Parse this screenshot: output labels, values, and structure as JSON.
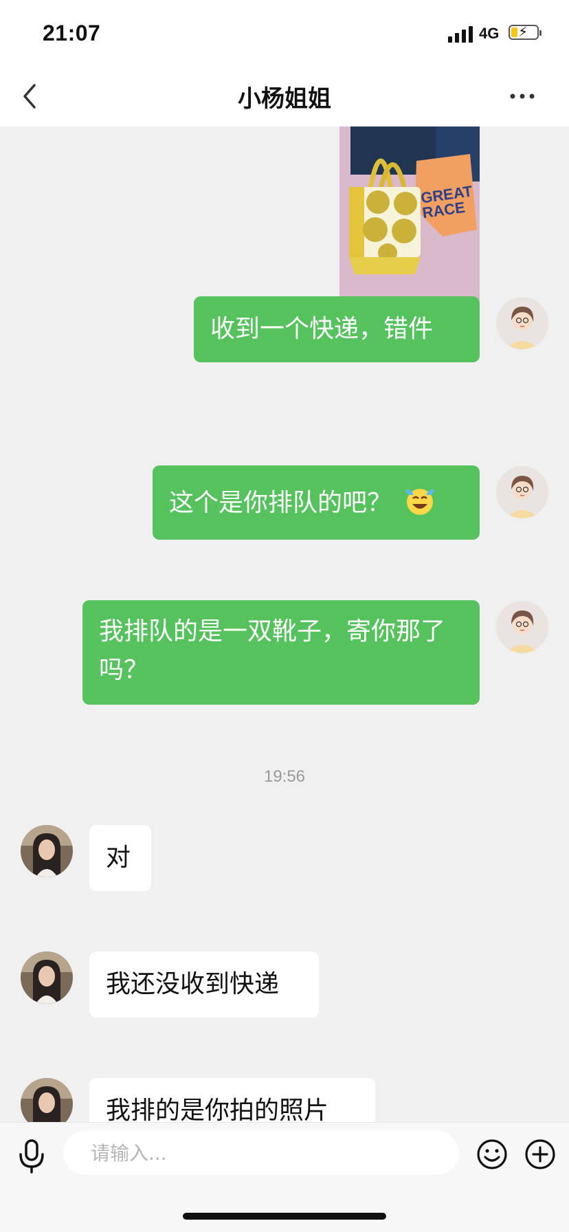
{
  "status_bar": {
    "time": "21:07",
    "network": "4G",
    "battery_level": 0.25
  },
  "nav": {
    "title": "小杨姐姐"
  },
  "messages": [
    {
      "from": "me",
      "type": "image",
      "text": ""
    },
    {
      "from": "me",
      "type": "text",
      "text": "收到一个快递，错件"
    },
    {
      "from": "me",
      "type": "text",
      "text": "这个是你排队的吧？",
      "emoji": "laughing-crying-emoji"
    },
    {
      "from": "me",
      "type": "text",
      "text": "我排队的是一双靴子，寄你那了吗？"
    },
    {
      "from": "other",
      "type": "text",
      "text": "对"
    },
    {
      "from": "other",
      "type": "text",
      "text": "我还没收到快递"
    },
    {
      "from": "other",
      "type": "text",
      "text": "我排的是你拍的照片"
    }
  ],
  "timestamp": "19:56",
  "input": {
    "placeholder": "请输入..."
  },
  "colors": {
    "my_bubble": "#55c25e",
    "other_bubble": "#ffffff",
    "background": "#f0f0f0"
  },
  "icons": [
    "back-icon",
    "more-icon",
    "mic-icon",
    "emoji-icon",
    "plus-icon"
  ]
}
